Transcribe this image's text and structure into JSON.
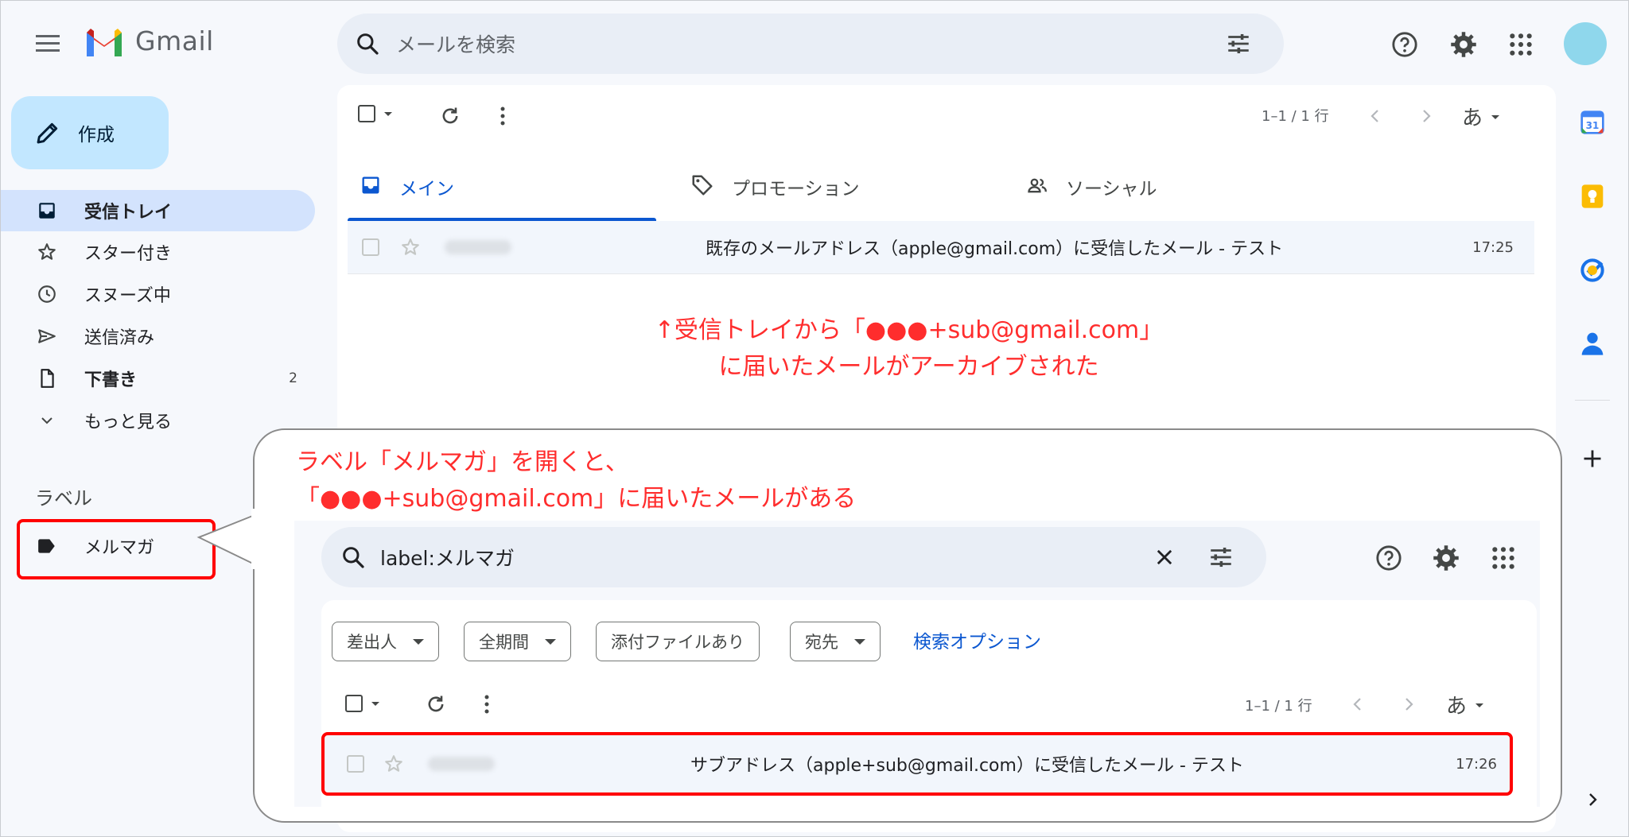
{
  "app": {
    "name": "Gmail"
  },
  "search": {
    "placeholder": "メールを検索"
  },
  "compose": {
    "label": "作成"
  },
  "sidebar": {
    "items": [
      {
        "label": "受信トレイ",
        "icon": "inbox-icon",
        "active": true,
        "bold": true,
        "count": ""
      },
      {
        "label": "スター付き",
        "icon": "star-icon",
        "active": false,
        "bold": false,
        "count": ""
      },
      {
        "label": "スヌーズ中",
        "icon": "clock-icon",
        "active": false,
        "bold": false,
        "count": ""
      },
      {
        "label": "送信済み",
        "icon": "send-icon",
        "active": false,
        "bold": false,
        "count": ""
      },
      {
        "label": "下書き",
        "icon": "draft-icon",
        "active": false,
        "bold": true,
        "count": "2"
      },
      {
        "label": "もっと見る",
        "icon": "chevron-down-icon",
        "active": false,
        "bold": false,
        "count": ""
      }
    ],
    "labels_heading": "ラベル",
    "labels": [
      {
        "label": "メルマガ",
        "icon": "label-icon"
      }
    ]
  },
  "toolbar": {
    "pager": "1–1 / 1 行",
    "input_tool": "あ"
  },
  "tabs": [
    {
      "label": "メイン",
      "icon": "inbox-icon",
      "active": true
    },
    {
      "label": "プロモーション",
      "icon": "tag-icon",
      "active": false
    },
    {
      "label": "ソーシャル",
      "icon": "people-icon",
      "active": false
    }
  ],
  "inbox_row": {
    "subject": "既存のメールアドレス（apple@gmail.com）に受信したメール - テスト",
    "time": "17:25"
  },
  "annotations": {
    "top_line1": "↑受信トレイから「●●●+sub@gmail.com」",
    "top_line2": "に届いたメールがアーカイブされた",
    "callout_line1": "ラベル「メルマガ」を開くと、",
    "callout_line2": "「●●●+sub@gmail.com」に届いたメールがある"
  },
  "inner": {
    "search_query": "label:メルマガ",
    "chips": [
      "差出人",
      "全期間",
      "添付ファイルあり",
      "宛先"
    ],
    "search_options": "検索オプション",
    "pager": "1–1 / 1 行",
    "input_tool": "あ",
    "row": {
      "subject": "サブアドレス（apple+sub@gmail.com）に受信したメール - テスト",
      "time": "17:26"
    }
  },
  "colors": {
    "accent": "#0b57d0",
    "active_nav": "#d3e3fd",
    "compose": "#c2e7ff",
    "annotation": "#ff2d2d",
    "highlight_box": "#ff0000"
  }
}
